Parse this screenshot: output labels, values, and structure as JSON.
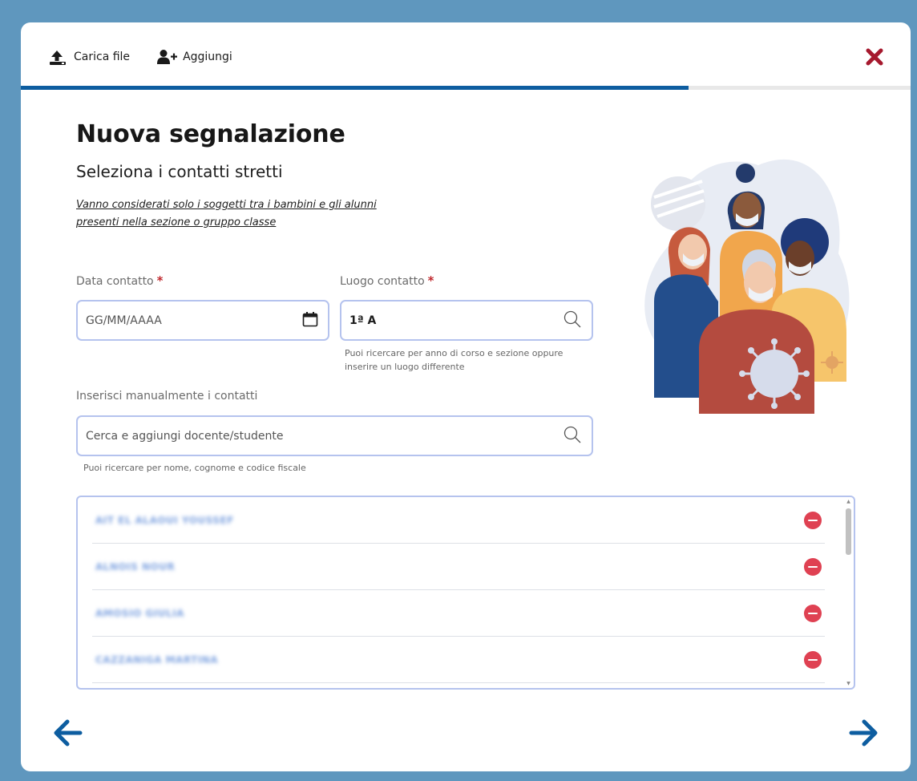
{
  "toolbar": {
    "upload_label": "Carica file",
    "add_label": "Aggiungi"
  },
  "progress": {
    "fraction": 0.75
  },
  "page": {
    "title": "Nuova segnalazione",
    "subtitle": "Seleziona i contatti stretti",
    "note_line1": "Vanno considerati solo i soggetti tra i bambini e gli alunni",
    "note_line2": "presenti nella sezione o gruppo classe"
  },
  "date_field": {
    "label": "Data contatto",
    "required_mark": "*",
    "placeholder": "GG/MM/AAAA"
  },
  "place_field": {
    "label": "Luogo contatto",
    "required_mark": "*",
    "value": "1ª A",
    "help_line1": "Puoi ricercare per anno di corso e sezione oppure",
    "help_line2": "inserire un luogo differente"
  },
  "manual_field": {
    "label": "Inserisci manualmente i contatti",
    "placeholder": "Cerca e aggiungi docente/studente",
    "help": "Puoi ricercare per nome, cognome e codice fiscale"
  },
  "contacts": [
    {
      "name": "AIT EL ALAOUI YOUSSEF"
    },
    {
      "name": "ALNOIS NOUR"
    },
    {
      "name": "AMOSIO GIULIA"
    },
    {
      "name": "CAZZANIGA MARTINA"
    }
  ],
  "colors": {
    "background": "#5f97be",
    "accent": "#0d5da0",
    "close": "#a6192e",
    "remove": "#df4152",
    "required": "#c0282d",
    "input_border": "#b5c3ee"
  },
  "icons": {
    "upload": "upload-icon",
    "add_user": "add-user-icon",
    "close": "close-icon",
    "calendar": "calendar-icon",
    "search": "search-icon",
    "remove": "remove-icon",
    "prev": "arrow-left-icon",
    "next": "arrow-right-icon"
  }
}
